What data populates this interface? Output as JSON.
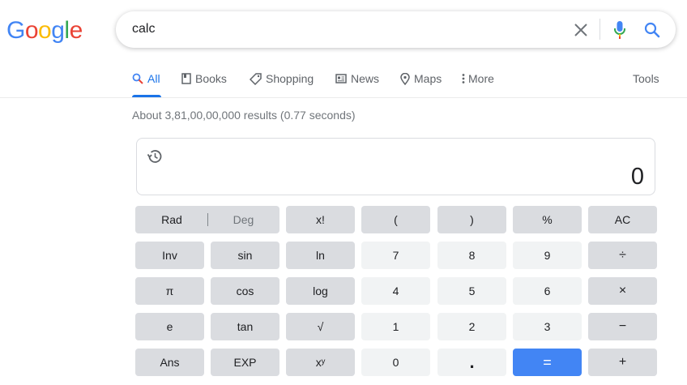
{
  "logo": {
    "letters": [
      "G",
      "o",
      "o",
      "g",
      "l",
      "e"
    ],
    "colors": [
      "#4285f4",
      "#ea4335",
      "#fbbc05",
      "#4285f4",
      "#34a853",
      "#ea4335"
    ]
  },
  "search": {
    "query": "calc"
  },
  "tabs": [
    {
      "label": "All",
      "icon": "search-icon"
    },
    {
      "label": "Books",
      "icon": "book-icon"
    },
    {
      "label": "Shopping",
      "icon": "tag-icon"
    },
    {
      "label": "News",
      "icon": "news-icon"
    },
    {
      "label": "Maps",
      "icon": "map-pin-icon"
    },
    {
      "label": "More",
      "icon": "more-vert-icon"
    }
  ],
  "tools_label": "Tools",
  "result_stats": "About 3,81,00,00,000 results (0.77 seconds)",
  "calculator": {
    "display": "0",
    "rad_label": "Rad",
    "deg_label": "Deg",
    "keys": {
      "fact": "x!",
      "lparen": "(",
      "rparen": ")",
      "percent": "%",
      "ac": "AC",
      "inv": "Inv",
      "sin": "sin",
      "ln": "ln",
      "k7": "7",
      "k8": "8",
      "k9": "9",
      "divide": "÷",
      "pi": "π",
      "cos": "cos",
      "log": "log",
      "k4": "4",
      "k5": "5",
      "k6": "6",
      "multiply": "×",
      "e": "e",
      "tan": "tan",
      "sqrt": "√",
      "k1": "1",
      "k2": "2",
      "k3": "3",
      "minus": "−",
      "ans": "Ans",
      "exp": "EXP",
      "pow": "xʸ",
      "k0": "0",
      "dot": ".",
      "equals": "=",
      "plus": "+"
    }
  }
}
